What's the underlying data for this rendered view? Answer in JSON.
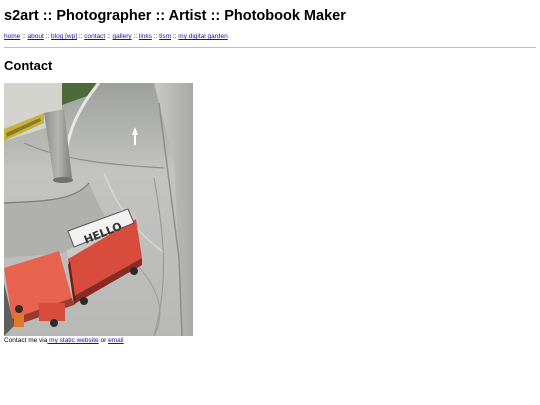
{
  "header": {
    "title": "s2art :: Photographer :: Artist :: Photobook Maker"
  },
  "nav": {
    "separator": "::",
    "items": [
      {
        "label": "home"
      },
      {
        "label": "about"
      },
      {
        "label": "blog [wp]"
      },
      {
        "label": "contact"
      },
      {
        "label": "gallery"
      },
      {
        "label": "links"
      },
      {
        "label": "tism"
      },
      {
        "label": "my digital garden"
      }
    ]
  },
  "main": {
    "heading": "Contact",
    "photo": {
      "cart_sign_text": "HELLO"
    },
    "contact": {
      "prefix": "Contact me via",
      "static_site_link": " my static website",
      "middle": " or ",
      "email_link": "email"
    }
  },
  "colors": {
    "link": "#1a0dab",
    "cart_red": "#e0574a",
    "road_gray": "#bfc0bd"
  }
}
